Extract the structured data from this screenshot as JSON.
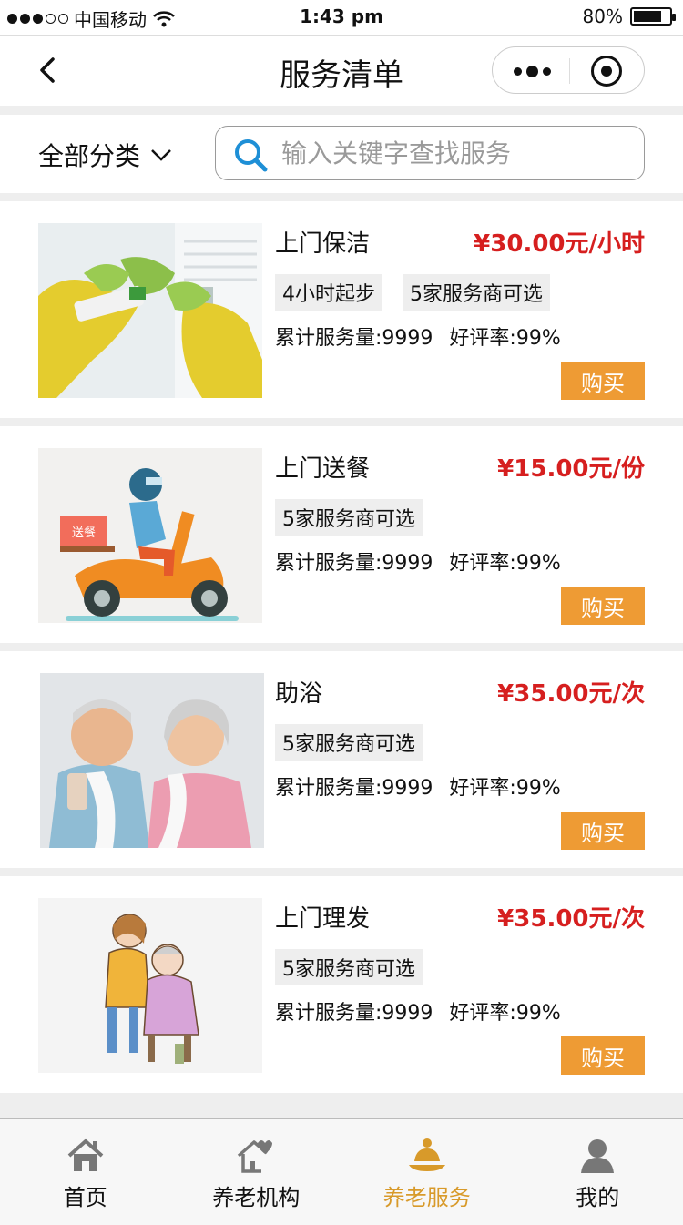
{
  "status_bar": {
    "carrier": "中国移动",
    "time": "1:43 pm",
    "battery": "80%",
    "battery_level": 0.8,
    "signal_bars_filled": 3,
    "signal_bars_total": 5
  },
  "nav": {
    "title": "服务清单",
    "icons": [
      "back-arrow-icon",
      "more-dots-icon",
      "close-target-icon"
    ]
  },
  "filter": {
    "category_label": "全部分类",
    "search_placeholder": "输入关键字查找服务"
  },
  "services": [
    {
      "name": "上门保洁",
      "price": "¥30.00元/小时",
      "tags": [
        "4小时起步",
        "5家服务商可选"
      ],
      "volume": "累计服务量:9999",
      "rating": "好评率:99%",
      "buy_label": "购买",
      "image": "cleaning-image"
    },
    {
      "name": "上门送餐",
      "price": "¥15.00元/份",
      "tags": [
        "5家服务商可选"
      ],
      "volume": "累计服务量:9999",
      "rating": "好评率:99%",
      "buy_label": "购买",
      "image": "delivery-image",
      "image_text": "送餐"
    },
    {
      "name": "助浴",
      "price": "¥35.00元/次",
      "tags": [
        "5家服务商可选"
      ],
      "volume": "累计服务量:9999",
      "rating": "好评率:99%",
      "buy_label": "购买",
      "image": "elderly-couple-image"
    },
    {
      "name": "上门理发",
      "price": "¥35.00元/次",
      "tags": [
        "5家服务商可选"
      ],
      "volume": "累计服务量:9999",
      "rating": "好评率:99%",
      "buy_label": "购买",
      "image": "haircut-image"
    }
  ],
  "tabbar": {
    "tabs": [
      {
        "label": "首页",
        "icon": "home-icon",
        "active": false
      },
      {
        "label": "养老机构",
        "icon": "institution-house-icon",
        "active": false
      },
      {
        "label": "养老服务",
        "icon": "service-bell-icon",
        "active": true
      },
      {
        "label": "我的",
        "icon": "user-icon",
        "active": false
      }
    ]
  },
  "colors": {
    "price": "#d61f1f",
    "buy_button": "#ee9b34",
    "active_tab": "#d89a2a",
    "search_icon": "#1e8fd6"
  }
}
